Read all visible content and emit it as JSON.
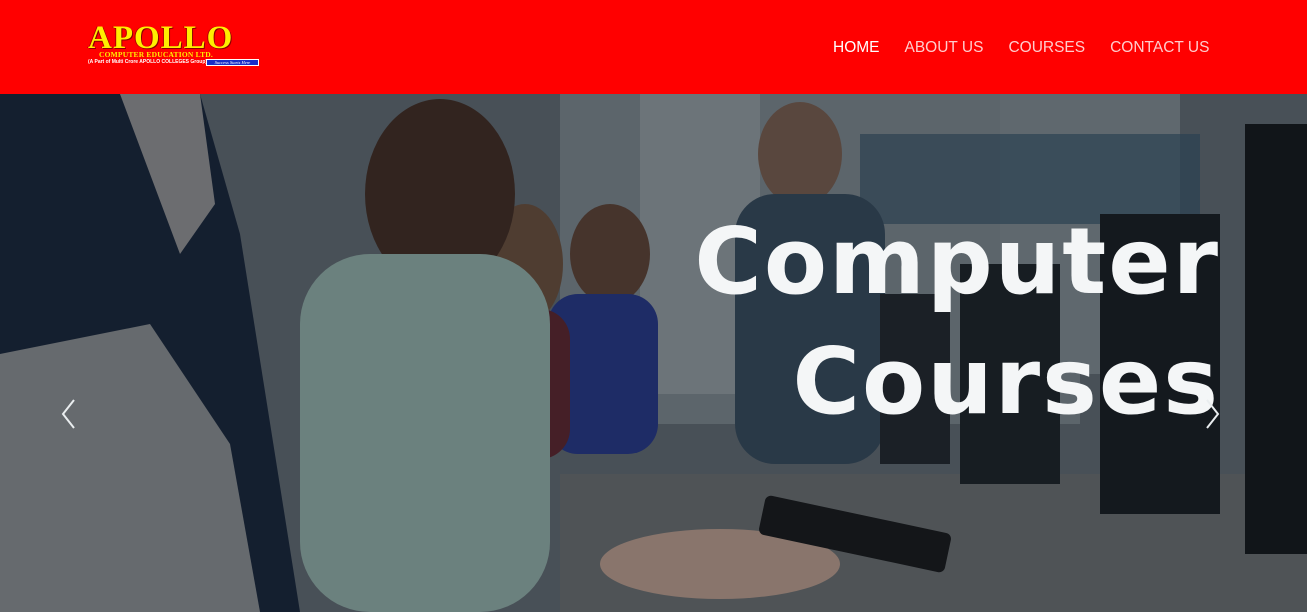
{
  "brand": {
    "name": "APOLLO",
    "subtitle": "COMPUTER EDUCATION LTD.",
    "group_note": "(A Part of Multi Crore APOLLO COLLEGES Group)",
    "tagline": "Success Starts Here"
  },
  "nav": {
    "items": [
      {
        "label": "HOME",
        "active": true
      },
      {
        "label": "ABOUT US",
        "active": false
      },
      {
        "label": "COURSES",
        "active": false
      },
      {
        "label": "CONTACT US",
        "active": false
      }
    ]
  },
  "hero": {
    "title_line1": "Computer",
    "title_line2": "Courses",
    "prev_icon": "chevron-left-icon",
    "next_icon": "chevron-right-icon"
  },
  "colors": {
    "navbar_bg": "#ff0000",
    "logo_text": "#ffee00",
    "nav_active": "#ffffff",
    "nav_inactive": "#ffcccc",
    "hero_title": "#f4f6f7"
  }
}
